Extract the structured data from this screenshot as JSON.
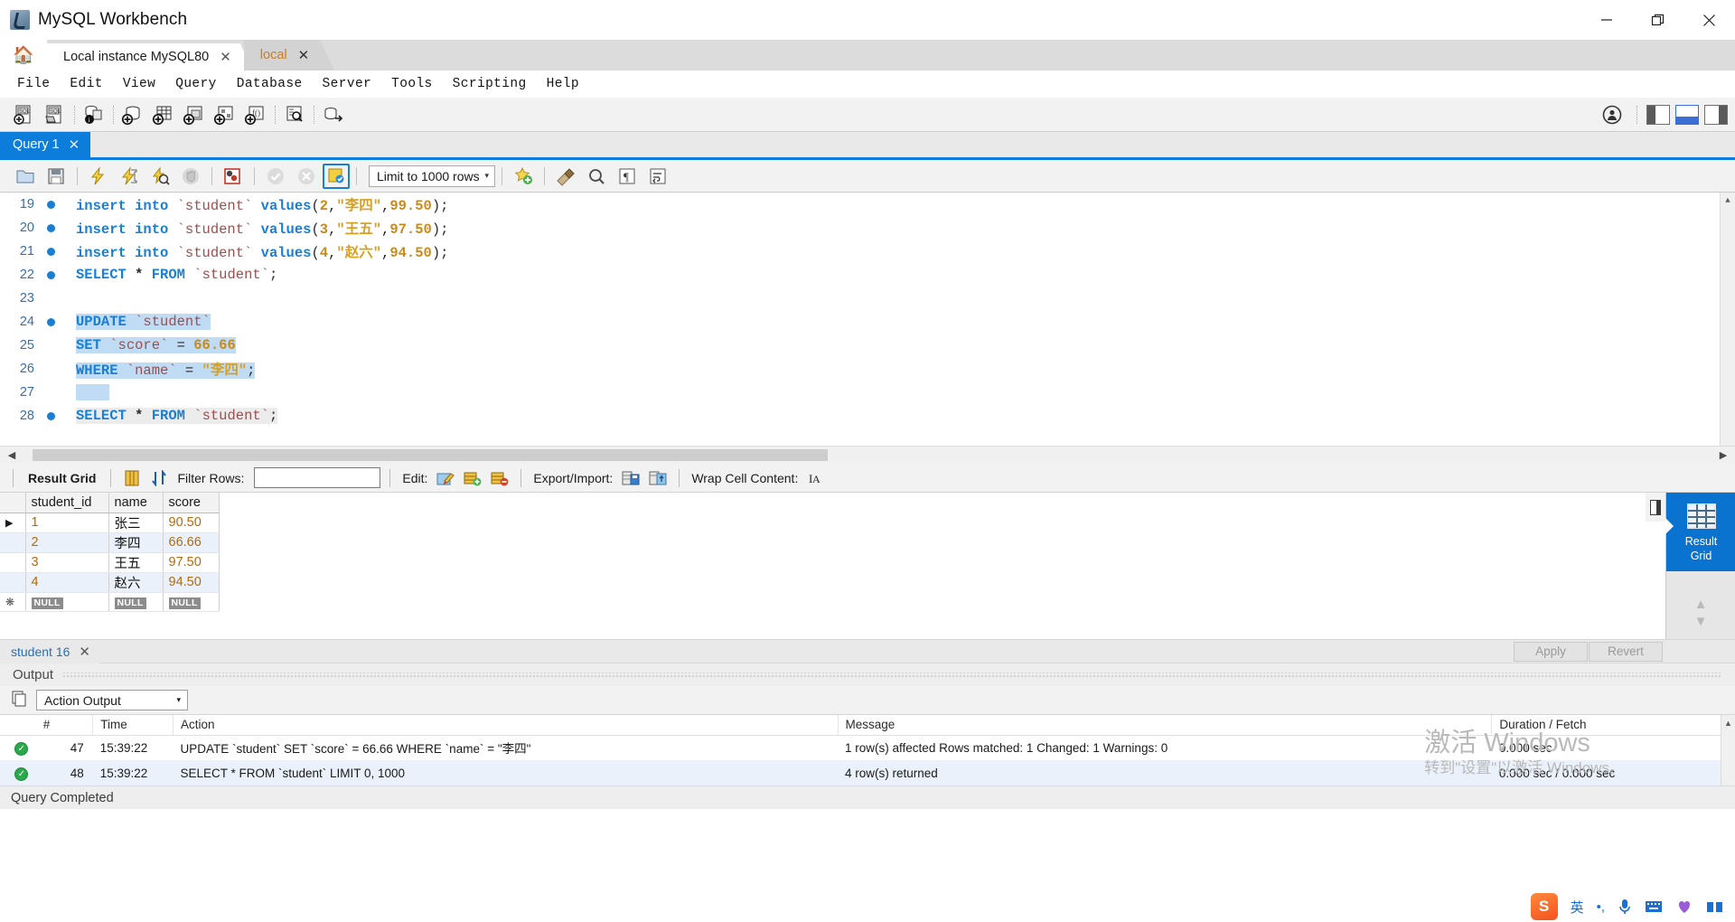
{
  "window": {
    "title": "MySQL Workbench",
    "minimize": "—",
    "maximize": "❐",
    "close": "✕"
  },
  "app_tabs": {
    "home_icon": "home-icon",
    "items": [
      {
        "label": "Local instance MySQL80",
        "close": "✕",
        "active": false
      },
      {
        "label": "local",
        "close": "✕",
        "active": true
      }
    ]
  },
  "menubar": {
    "items": [
      "File",
      "Edit",
      "View",
      "Query",
      "Database",
      "Server",
      "Tools",
      "Scripting",
      "Help"
    ]
  },
  "main_toolbar": {
    "icons": [
      "new-sql-tab-icon",
      "open-sql-script-icon",
      "server-status-icon",
      "new-schema-icon",
      "new-table-icon",
      "new-view-icon",
      "new-routine-icon",
      "new-function-icon",
      "search-icon",
      "reconnect-dbms-icon"
    ],
    "right_icons": [
      "account-icon",
      "toggle-left-panel",
      "toggle-bottom-panel",
      "toggle-right-panel"
    ]
  },
  "query_tabs": {
    "items": [
      {
        "label": "Query 1",
        "close": "✕"
      }
    ]
  },
  "query_toolbar": {
    "icons": [
      "open-file-icon",
      "save-file-icon",
      "execute-icon",
      "execute-current-icon",
      "explain-icon",
      "stop-icon",
      "toggle-stop-on-error-icon",
      "commit-icon",
      "rollback-icon",
      "autocommit-icon"
    ],
    "limit_label": "Limit to 1000 rows",
    "limit_caret": "▾",
    "right_icons": [
      "beautify-icon",
      "find-icon",
      "toggle-invisible-chars-icon",
      "wrap-lines-icon"
    ]
  },
  "editor": {
    "lines": [
      {
        "num": "19",
        "dot": true,
        "sel": "none",
        "tokens": [
          {
            "t": "insert into ",
            "c": "kw"
          },
          {
            "t": "`student`",
            "c": "ident"
          },
          {
            "t": " ",
            "c": "punct"
          },
          {
            "t": "values",
            "c": "kw"
          },
          {
            "t": "(",
            "c": "punct"
          },
          {
            "t": "2",
            "c": "num"
          },
          {
            "t": ",",
            "c": "punct"
          },
          {
            "t": "\"李四\"",
            "c": "str"
          },
          {
            "t": ",",
            "c": "punct"
          },
          {
            "t": "99.50",
            "c": "num"
          },
          {
            "t": ");",
            "c": "punct"
          }
        ]
      },
      {
        "num": "20",
        "dot": true,
        "sel": "none",
        "tokens": [
          {
            "t": "insert into ",
            "c": "kw"
          },
          {
            "t": "`student`",
            "c": "ident"
          },
          {
            "t": " ",
            "c": "punct"
          },
          {
            "t": "values",
            "c": "kw"
          },
          {
            "t": "(",
            "c": "punct"
          },
          {
            "t": "3",
            "c": "num"
          },
          {
            "t": ",",
            "c": "punct"
          },
          {
            "t": "\"王五\"",
            "c": "str"
          },
          {
            "t": ",",
            "c": "punct"
          },
          {
            "t": "97.50",
            "c": "num"
          },
          {
            "t": ");",
            "c": "punct"
          }
        ]
      },
      {
        "num": "21",
        "dot": true,
        "sel": "none",
        "tokens": [
          {
            "t": "insert into ",
            "c": "kw"
          },
          {
            "t": "`student`",
            "c": "ident"
          },
          {
            "t": " ",
            "c": "punct"
          },
          {
            "t": "values",
            "c": "kw"
          },
          {
            "t": "(",
            "c": "punct"
          },
          {
            "t": "4",
            "c": "num"
          },
          {
            "t": ",",
            "c": "punct"
          },
          {
            "t": "\"赵六\"",
            "c": "str"
          },
          {
            "t": ",",
            "c": "punct"
          },
          {
            "t": "94.50",
            "c": "num"
          },
          {
            "t": ");",
            "c": "punct"
          }
        ]
      },
      {
        "num": "22",
        "dot": true,
        "sel": "none",
        "tokens": [
          {
            "t": "SELECT ",
            "c": "kw"
          },
          {
            "t": "*",
            "c": "star"
          },
          {
            "t": " ",
            "c": "punct"
          },
          {
            "t": "FROM ",
            "c": "kw"
          },
          {
            "t": "`student`",
            "c": "ident"
          },
          {
            "t": ";",
            "c": "punct"
          }
        ]
      },
      {
        "num": "23",
        "dot": false,
        "sel": "none",
        "tokens": []
      },
      {
        "num": "24",
        "dot": true,
        "sel": "blue",
        "tokens": [
          {
            "t": "UPDATE ",
            "c": "kw"
          },
          {
            "t": "`student`",
            "c": "ident"
          }
        ]
      },
      {
        "num": "25",
        "dot": false,
        "sel": "blue",
        "tokens": [
          {
            "t": "SET ",
            "c": "kw"
          },
          {
            "t": "`score`",
            "c": "ident"
          },
          {
            "t": " = ",
            "c": "punct"
          },
          {
            "t": "66.66",
            "c": "num"
          }
        ]
      },
      {
        "num": "26",
        "dot": false,
        "sel": "blue",
        "tokens": [
          {
            "t": "WHERE ",
            "c": "kw"
          },
          {
            "t": "`name`",
            "c": "ident"
          },
          {
            "t": " = ",
            "c": "punct"
          },
          {
            "t": "\"李四\"",
            "c": "str"
          },
          {
            "t": ";",
            "c": "punct"
          }
        ]
      },
      {
        "num": "27",
        "dot": false,
        "sel": "blue",
        "tokens": [
          {
            "t": "    ",
            "c": "punct"
          }
        ]
      },
      {
        "num": "28",
        "dot": true,
        "sel": "gray",
        "tokens": [
          {
            "t": "SELECT ",
            "c": "kw"
          },
          {
            "t": "*",
            "c": "star"
          },
          {
            "t": " ",
            "c": "punct"
          },
          {
            "t": "FROM ",
            "c": "kw"
          },
          {
            "t": "`student`",
            "c": "ident"
          },
          {
            "t": ";",
            "c": "punct"
          }
        ]
      }
    ]
  },
  "result_toolbar": {
    "result_grid_label": "Result Grid",
    "grid_view_icon": "grid-view-icon",
    "refresh_icon": "refresh-icon",
    "filter_label": "Filter Rows:",
    "filter_value": "",
    "edit_label": "Edit:",
    "edit_icons": [
      "edit-pencil-icon",
      "insert-row-icon",
      "delete-row-icon"
    ],
    "export_label": "Export/Import:",
    "export_icons": [
      "export-recordset-icon",
      "import-recordset-icon"
    ],
    "wrap_label": "Wrap Cell Content:",
    "wrap_icon": "wrap-cell-icon"
  },
  "result_grid": {
    "columns": [
      "",
      "student_id",
      "name",
      "score"
    ],
    "rows": [
      {
        "marker": "▶",
        "student_id": "1",
        "name": "张三",
        "score": "90.50"
      },
      {
        "marker": "",
        "student_id": "2",
        "name": "李四",
        "score": "66.66"
      },
      {
        "marker": "",
        "student_id": "3",
        "name": "王五",
        "score": "97.50"
      },
      {
        "marker": "",
        "student_id": "4",
        "name": "赵六",
        "score": "94.50"
      }
    ],
    "new_row": {
      "marker": "✱",
      "student_id": "NULL",
      "name": "NULL",
      "score": "NULL"
    },
    "footer_tab": "student 16",
    "footer_tab_close": "✕",
    "apply_label": "Apply",
    "revert_label": "Revert"
  },
  "side_panel": {
    "active_label_line1": "Result",
    "active_label_line2": "Grid",
    "active_icon": "result-grid-icon"
  },
  "output": {
    "panel_title": "Output",
    "selector_value": "Action Output",
    "selector_caret": "▾",
    "copy_icon": "copy-icon",
    "columns": [
      "",
      "#",
      "Time",
      "Action",
      "Message",
      "Duration / Fetch"
    ],
    "rows": [
      {
        "status": "success",
        "num": "47",
        "time": "15:39:22",
        "action": "UPDATE `student` SET `score` = 66.66 WHERE `name` = \"李四\"",
        "message": "1 row(s) affected Rows matched: 1  Changed: 1  Warnings: 0",
        "duration": "0.000 sec"
      },
      {
        "status": "success",
        "num": "48",
        "time": "15:39:22",
        "action": "SELECT * FROM `student` LIMIT 0, 1000",
        "message": "4 row(s) returned",
        "duration": "0.000 sec / 0.000 sec"
      }
    ]
  },
  "watermark": {
    "line1": "激活 Windows",
    "line2": "转到\"设置\"以激活 Windows。"
  },
  "statusbar": {
    "text": "Query Completed"
  },
  "taskbar": {
    "sogou": "S",
    "items": [
      "英",
      "•,",
      "mic-icon",
      "keyboard-icon",
      "heart-icon",
      "people-icon"
    ]
  },
  "colors": {
    "accent_blue": "#0d7ddb",
    "selection_blue": "#bfdcf4",
    "keyword_blue": "#1a7fd4",
    "string_gold": "#d8a021",
    "identifier_red": "#9b4f4f",
    "success_green": "#2aa84a",
    "tab_active_orange": "#c77d2a"
  }
}
